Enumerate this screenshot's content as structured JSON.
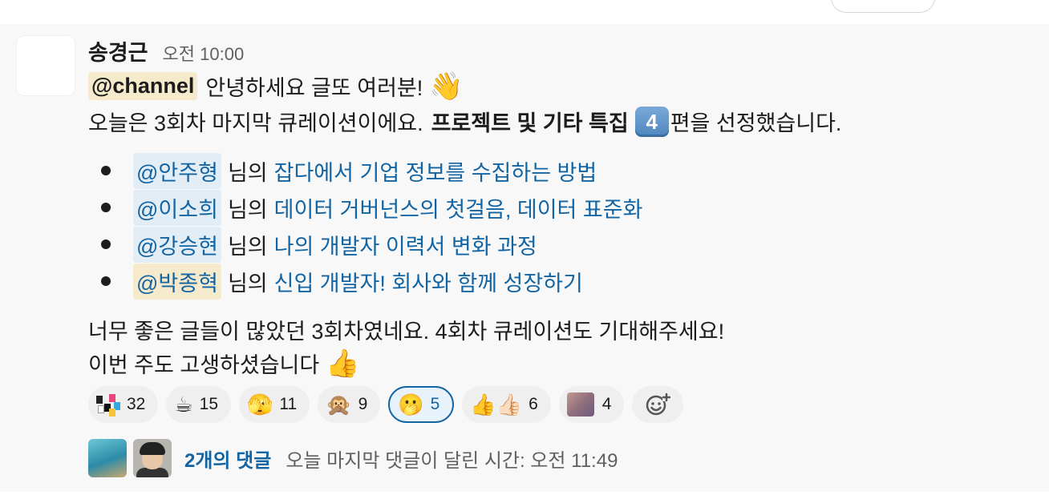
{
  "message": {
    "sender": "송경근",
    "time": "오전 10:00",
    "line1": {
      "mention": "@channel",
      "text": "안녕하세요 글또 여러분!",
      "emoji": "👋"
    },
    "line2": {
      "text_before": "오늘은 3회차 마지막 큐레이션이에요.",
      "bold_text": "프로젝트 및 기타 특집",
      "keycap": "4",
      "text_after": "편을 선정했습니다."
    },
    "items": [
      {
        "mention": "@안주형",
        "suffix": "님의",
        "link": "잡다에서 기업 정보를 수집하는 방법"
      },
      {
        "mention": "@이소희",
        "suffix": "님의",
        "link": "데이터 거버넌스의 첫걸음, 데이터 표준화"
      },
      {
        "mention": "@강승현",
        "suffix": "님의",
        "link": "나의 개발자 이력서 변화 과정"
      },
      {
        "mention": "@박종혁",
        "suffix": "님의",
        "link": "신입 개발자! 회사와 함께 성장하기"
      }
    ],
    "closing1": "너무 좋은 글들이 많았던 3회차였네요. 4회차 큐레이션도 기대해주세요!",
    "closing2": "이번 주도 고생하셨습니다",
    "closing2_emoji": "👍"
  },
  "reactions": [
    {
      "emoji": "mosaic-emoji",
      "count": "32"
    },
    {
      "emoji": "☕",
      "count": "15"
    },
    {
      "emoji": "🫣",
      "count": "11"
    },
    {
      "emoji": "🙊",
      "count": "9"
    },
    {
      "emoji": "🫢",
      "count": "5"
    },
    {
      "emoji": "👍👍🏻",
      "count": "6"
    },
    {
      "emoji": "face-emoji",
      "count": "4"
    }
  ],
  "thread": {
    "reply_count": "2개의 댓글",
    "last_reply": "오늘 마지막 댓글이 달린 시간: 오전 11:49"
  }
}
